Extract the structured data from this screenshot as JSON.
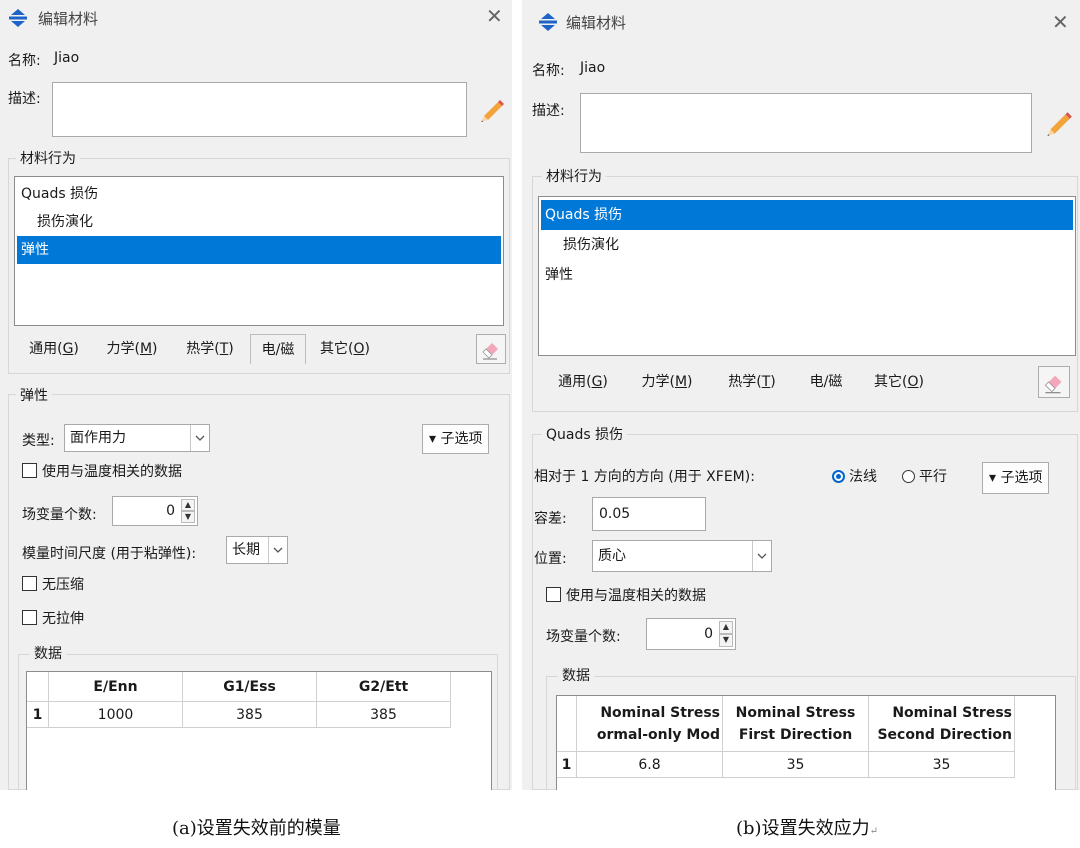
{
  "dialog_a": {
    "title": "编辑材料",
    "name_label": "名称:",
    "name_value": "Jiao",
    "desc_label": "描述:",
    "behavior_group": "材料行为",
    "behaviors": [
      "Quads 损伤",
      "损伤演化",
      "弹性"
    ],
    "selected_behavior": "弹性",
    "tabs": [
      {
        "label": "通用",
        "key": "(G)",
        "key_letter": "G"
      },
      {
        "label": "力学",
        "key": "(M)",
        "key_letter": "M"
      },
      {
        "label": "热学",
        "key": "(T)",
        "key_letter": "T"
      },
      {
        "label": "电/磁",
        "key": "",
        "key_letter": ""
      },
      {
        "label": "其它",
        "key": "(O)",
        "key_letter": "O"
      }
    ],
    "section_title": "弹性",
    "type_label": "类型:",
    "type_value": "面作用力",
    "suboptions": "▾ 子选项",
    "temp_dep": "使用与温度相关的数据",
    "field_vars_label": "场变量个数:",
    "field_vars_value": "0",
    "moduli_label": "模量时间尺度 (用于粘弹性):",
    "moduli_value": "长期",
    "no_compression": "无压缩",
    "no_tension": "无拉伸",
    "data_group": "数据",
    "table": {
      "headers": [
        "E/Enn",
        "G1/Ess",
        "G2/Ett"
      ],
      "rows": [
        {
          "index": "1",
          "values": [
            "1000",
            "385",
            "385"
          ]
        }
      ]
    }
  },
  "dialog_b": {
    "title": "编辑材料",
    "name_label": "名称:",
    "name_value": "Jiao",
    "desc_label": "描述:",
    "behavior_group": "材料行为",
    "behaviors": [
      "Quads 损伤",
      "损伤演化",
      "弹性"
    ],
    "selected_behavior": "Quads 损伤",
    "tabs": [
      {
        "label": "通用",
        "key": "(G)",
        "key_letter": "G"
      },
      {
        "label": "力学",
        "key": "(M)",
        "key_letter": "M"
      },
      {
        "label": "热学",
        "key": "(T)",
        "key_letter": "T"
      },
      {
        "label": "电/磁",
        "key": "",
        "key_letter": ""
      },
      {
        "label": "其它",
        "key": "(O)",
        "key_letter": "O"
      }
    ],
    "section_title": "Quads 损伤",
    "direction_label": "相对于 1 方向的方向 (用于 XFEM):",
    "radio_normal": "法线",
    "radio_parallel": "平行",
    "radio_selected": "法线",
    "suboptions": "▾ 子选项",
    "tolerance_label": "容差:",
    "tolerance_value": "0.05",
    "position_label": "位置:",
    "position_value": "质心",
    "temp_dep": "使用与温度相关的数据",
    "field_vars_label": "场变量个数:",
    "field_vars_value": "0",
    "data_group": "数据",
    "table": {
      "headers": [
        [
          "Nominal Stress",
          "ormal-only Mod"
        ],
        [
          "Nominal Stress",
          "First Direction"
        ],
        [
          "Nominal Stress",
          "Second Direction"
        ]
      ],
      "rows": [
        {
          "index": "1",
          "values": [
            "6.8",
            "35",
            "35"
          ]
        }
      ]
    }
  },
  "captions": {
    "a": "(a)设置失效前的模量",
    "b": "(b)设置失效应力",
    "b_mark": "↵"
  },
  "colors": {
    "selection": "#0078d7",
    "dialog_bg": "#f0f0f0",
    "radio_accent": "#0066cc"
  },
  "icons": {
    "app": "abaqus-diamond-icon",
    "edit": "pencil-icon",
    "eraser": "eraser-icon",
    "close": "close-icon"
  }
}
